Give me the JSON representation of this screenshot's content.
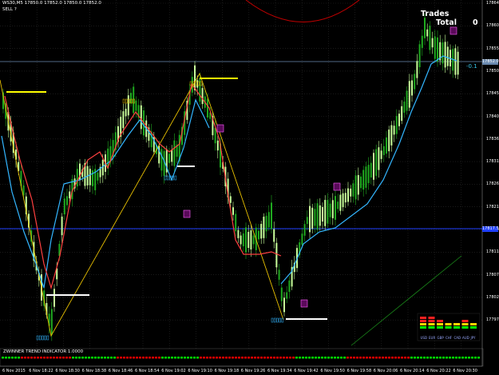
{
  "header": {
    "symbol_info": "WS30,M5  17850.0 17852.0 17850.0 17852.0",
    "signal": "SELL ?"
  },
  "trade_panel": {
    "trades_label": "Trades",
    "total_label": "Total",
    "total_value": "0"
  },
  "indicator": {
    "current_value": "-0.1",
    "panel_title": "ZWINNER TREND INDICATOR 1.0000"
  },
  "price_axis": {
    "ticks": [
      "17864.5",
      "17860.0",
      "17855.5",
      "17850.5",
      "17845.5",
      "17840.5",
      "17836.0",
      "17831.0",
      "17826.0",
      "17821.5",
      "17816.5",
      "17811.5",
      "17807.0",
      "17802.0",
      "17797.0"
    ],
    "current_price_tag": "17852.0",
    "level_tag": "17817.5"
  },
  "time_axis": {
    "ticks": [
      "6 Nov 2015",
      "6 Nov 18:22",
      "6 Nov 18:30",
      "6 Nov 18:38",
      "6 Nov 18:46",
      "6 Nov 18:54",
      "6 Nov 19:02",
      "6 Nov 19:10",
      "6 Nov 19:18",
      "6 Nov 19:26",
      "6 Nov 19:34",
      "6 Nov 19:42",
      "6 Nov 19:50",
      "6 Nov 19:58",
      "6 Nov 20:06",
      "6 Nov 20:14",
      "6 Nov 20:22",
      "6 Nov 20:30"
    ]
  },
  "currency_meter": {
    "labels": [
      "USD",
      "EUR",
      "GBP",
      "CHF",
      "CAD",
      "AUD",
      "JPY"
    ],
    "colors": {
      "strong": "#00ff00",
      "mid": "#ffd700",
      "weak": "#ff2020"
    }
  },
  "colors": {
    "bull_candle": "#1faa1f",
    "bear_candle": "#c8ff9a",
    "signal_line": "#ffff00",
    "trend_up": "#33b6ff",
    "trend_down": "#ff4040",
    "zigzag": "#e8c000",
    "hline": "#3050ff",
    "indicator_up": "#00e000",
    "indicator_down": "#e00000"
  }
}
